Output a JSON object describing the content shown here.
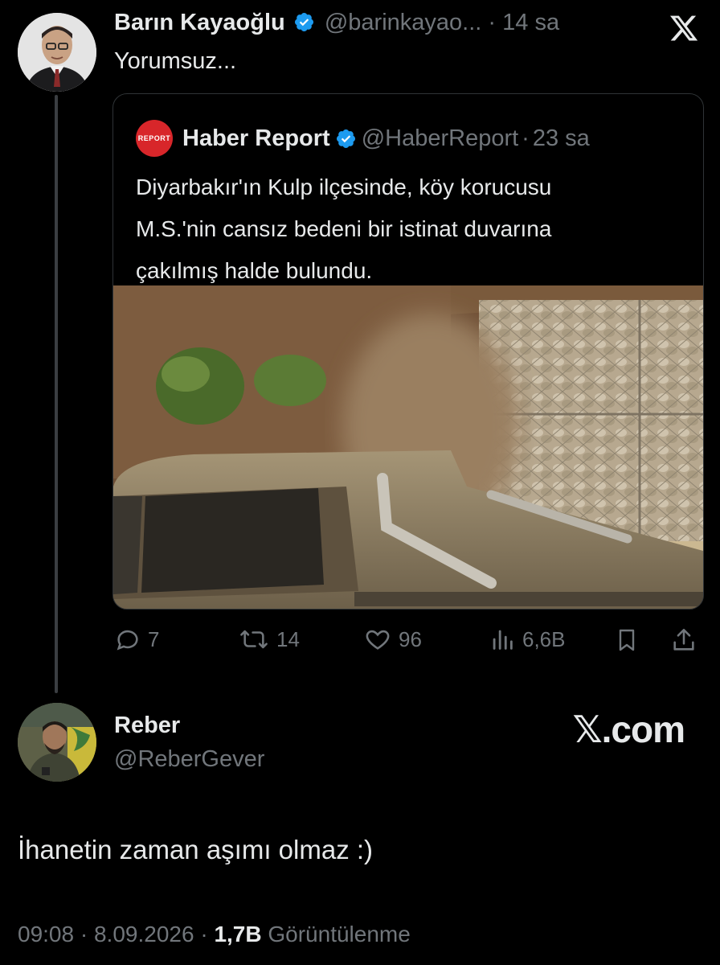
{
  "top_tweet": {
    "author_name": "Barın Kayaoğlu",
    "handle": "@barinkayao...",
    "separator": "·",
    "time": "14 sa",
    "text": "Yorumsuz..."
  },
  "quoted_tweet": {
    "logo_text": "REPORT",
    "author_name": "Haber Report",
    "handle": "@HaberReport",
    "separator": "·",
    "time": "23 sa",
    "text_line1": "Diyarbakır'ın Kulp ilçesinde, köy korucusu",
    "text_line2": "M.S.'nin cansız bedeni bir istinat duvarına",
    "text_line3": "çakılmış halde bulundu."
  },
  "actions": {
    "replies": "7",
    "retweets": "14",
    "likes": "96",
    "views": "6,6B"
  },
  "reply_tweet": {
    "author_name": "Reber",
    "handle": "@ReberGever",
    "watermark_x": "𝕏",
    "watermark_rest": ".com",
    "text": "İhanetin zaman aşımı olmaz :)",
    "time": "09:08",
    "separator1": "·",
    "date": "8.09.2026",
    "separator2": "·",
    "views": "1,7B",
    "views_label": "Görüntülenme"
  },
  "colors": {
    "background": "#000000",
    "text": "#e7e9ea",
    "muted": "#71767b",
    "verified": "#1d9bf0",
    "border": "#2f3336",
    "report_red": "#d8262a"
  },
  "icons": [
    "verified-badge-icon",
    "x-logo-icon",
    "reply-icon",
    "retweet-icon",
    "like-icon",
    "views-icon",
    "bookmark-icon",
    "share-icon"
  ]
}
